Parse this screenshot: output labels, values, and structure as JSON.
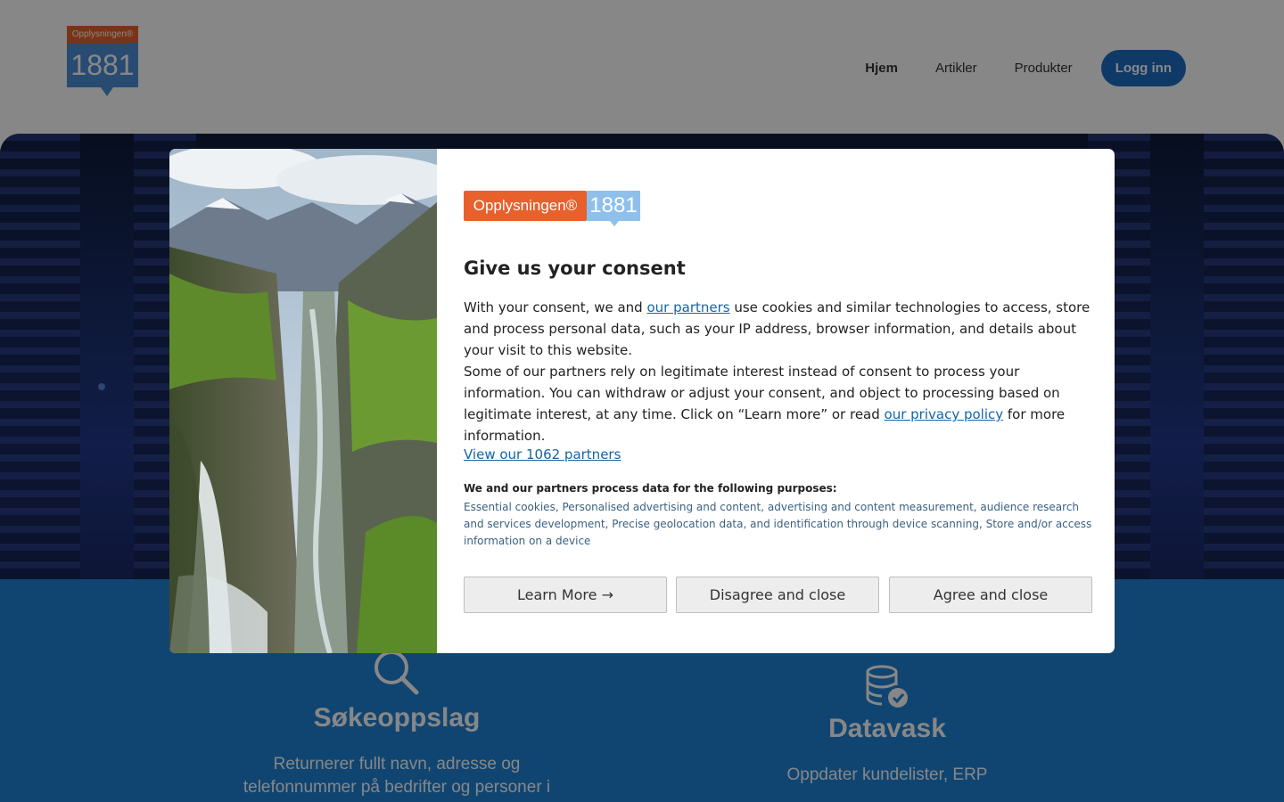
{
  "header": {
    "logo": {
      "top_text": "Opplysningen®",
      "number": "1881"
    },
    "nav": [
      {
        "label": "Hjem",
        "active": true
      },
      {
        "label": "Artikler"
      },
      {
        "label": "Produkter"
      }
    ],
    "login_label": "Logg inn"
  },
  "features": [
    {
      "icon": "search-icon",
      "title": "Søkeoppslag",
      "desc_lines": [
        "Returnerer fullt navn, adresse og",
        "telefonnummer på bedrifter og personer i"
      ]
    },
    {
      "icon": "database-check-icon",
      "title": "Datavask",
      "desc_lines": [
        "Oppdater kundelister, ERP"
      ]
    }
  ],
  "consent": {
    "brand": {
      "name": "Opplysningen®",
      "number": "1881"
    },
    "title": "Give us your consent",
    "paragraph1": {
      "before": "With your consent, we and ",
      "link": "our partners",
      "after": " use cookies and similar technologies to access, store and process personal data, such as your IP address, browser information, and details about your visit to this website."
    },
    "paragraph2": {
      "before": "Some of our partners rely on legitimate interest instead of consent to process your information. You can withdraw or adjust your consent, and object to processing based on legitimate interest, at any time. Click on “Learn more” or read ",
      "link": "our privacy policy",
      "after": " for more information."
    },
    "partners_link": "View our 1062 partners",
    "purposes_heading": "We and our partners process data for the following purposes:",
    "purposes": "Essential cookies, Personalised advertising and content, advertising and content measurement, audience research and services development, Precise geolocation data, and identification through device scanning, Store and/or access information on a device",
    "buttons": {
      "learn_more": "Learn More →",
      "disagree": "Disagree and close",
      "agree": "Agree and close"
    }
  },
  "colors": {
    "brand_orange": "#e8602c",
    "brand_blue": "#4d8fd6",
    "login_button": "#1d6fc2",
    "link": "#1565a8",
    "features_bg": "#1f83d6"
  }
}
